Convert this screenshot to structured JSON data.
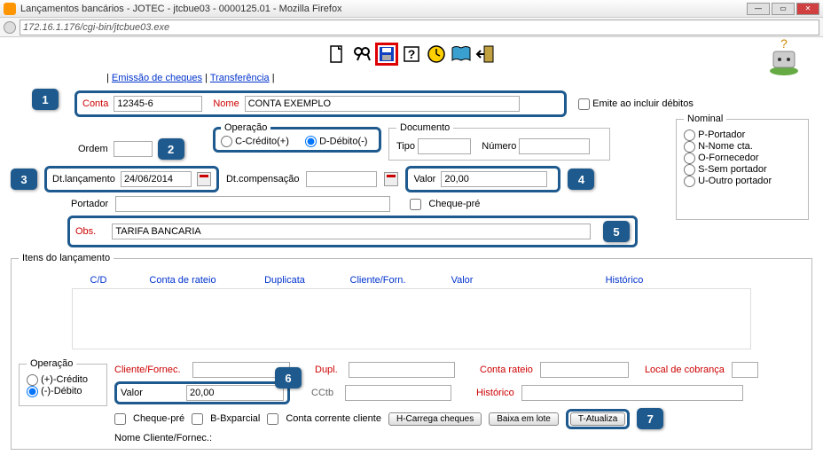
{
  "window": {
    "title": "Lançamentos bancários - JOTEC - jtcbue03 - 0000125.01 - Mozilla Firefox",
    "address": "172.16.1.176/cgi-bin/jtcbue03.exe"
  },
  "links": {
    "emissao": "Emissão de cheques",
    "transf": "Transferência"
  },
  "fields": {
    "conta_label": "Conta",
    "conta_value": "12345-6",
    "nome_label": "Nome",
    "nome_value": "CONTA EXEMPLO",
    "emite_label": "Emite ao incluir débitos",
    "ordem_label": "Ordem",
    "op_legend": "Operação",
    "credito": "C-Crédito(+)",
    "debito": "D-Débito(-)",
    "doc_legend": "Documento",
    "tipo_label": "Tipo",
    "numero_label": "Número",
    "nominal_legend": "Nominal",
    "p": "P-Portador",
    "n": "N-Nome cta.",
    "o": "O-Fornecedor",
    "s": "S-Sem portador",
    "u": "U-Outro portador",
    "dtlanc_label": "Dt.lançamento",
    "dtlanc_value": "24/06/2014",
    "dtcomp_label": "Dt.compensação",
    "valor_label": "Valor",
    "valor_value": "20,00",
    "portador_label": "Portador",
    "chequepre_label": "Cheque-pré",
    "obs_label": "Obs.",
    "obs_value": "TARIFA BANCARIA"
  },
  "itens": {
    "legend": "Itens do lançamento",
    "th_cd": "C/D",
    "th_conta": "Conta de rateio",
    "th_dupl": "Duplicata",
    "th_cli": "Cliente/Forn.",
    "th_valor": "Valor",
    "th_hist": "Histórico"
  },
  "op2": {
    "legend": "Operação",
    "credito": "(+)-Crédito",
    "debito": "(-)-Débito",
    "cliente_label": "Cliente/Fornec.",
    "valor_label": "Valor",
    "valor_value": "20,00",
    "dupl_label": "Dupl.",
    "cctb_label": "CCtb",
    "conta_rateio_label": "Conta rateio",
    "historico_label": "Histórico",
    "local_label": "Local de cobrança",
    "chequepre": "Cheque-pré",
    "bbx": "B-Bxparcial",
    "ccc": "Conta corrente cliente",
    "btn_carrega": "H-Carrega cheques",
    "btn_baixa": "Baixa em lote",
    "btn_atualiza": "T-Atualiza",
    "nome_cli": "Nome Cliente/Fornec.:"
  },
  "numbers": {
    "n1": "1",
    "n2": "2",
    "n3": "3",
    "n4": "4",
    "n5": "5",
    "n6": "6",
    "n7": "7"
  }
}
